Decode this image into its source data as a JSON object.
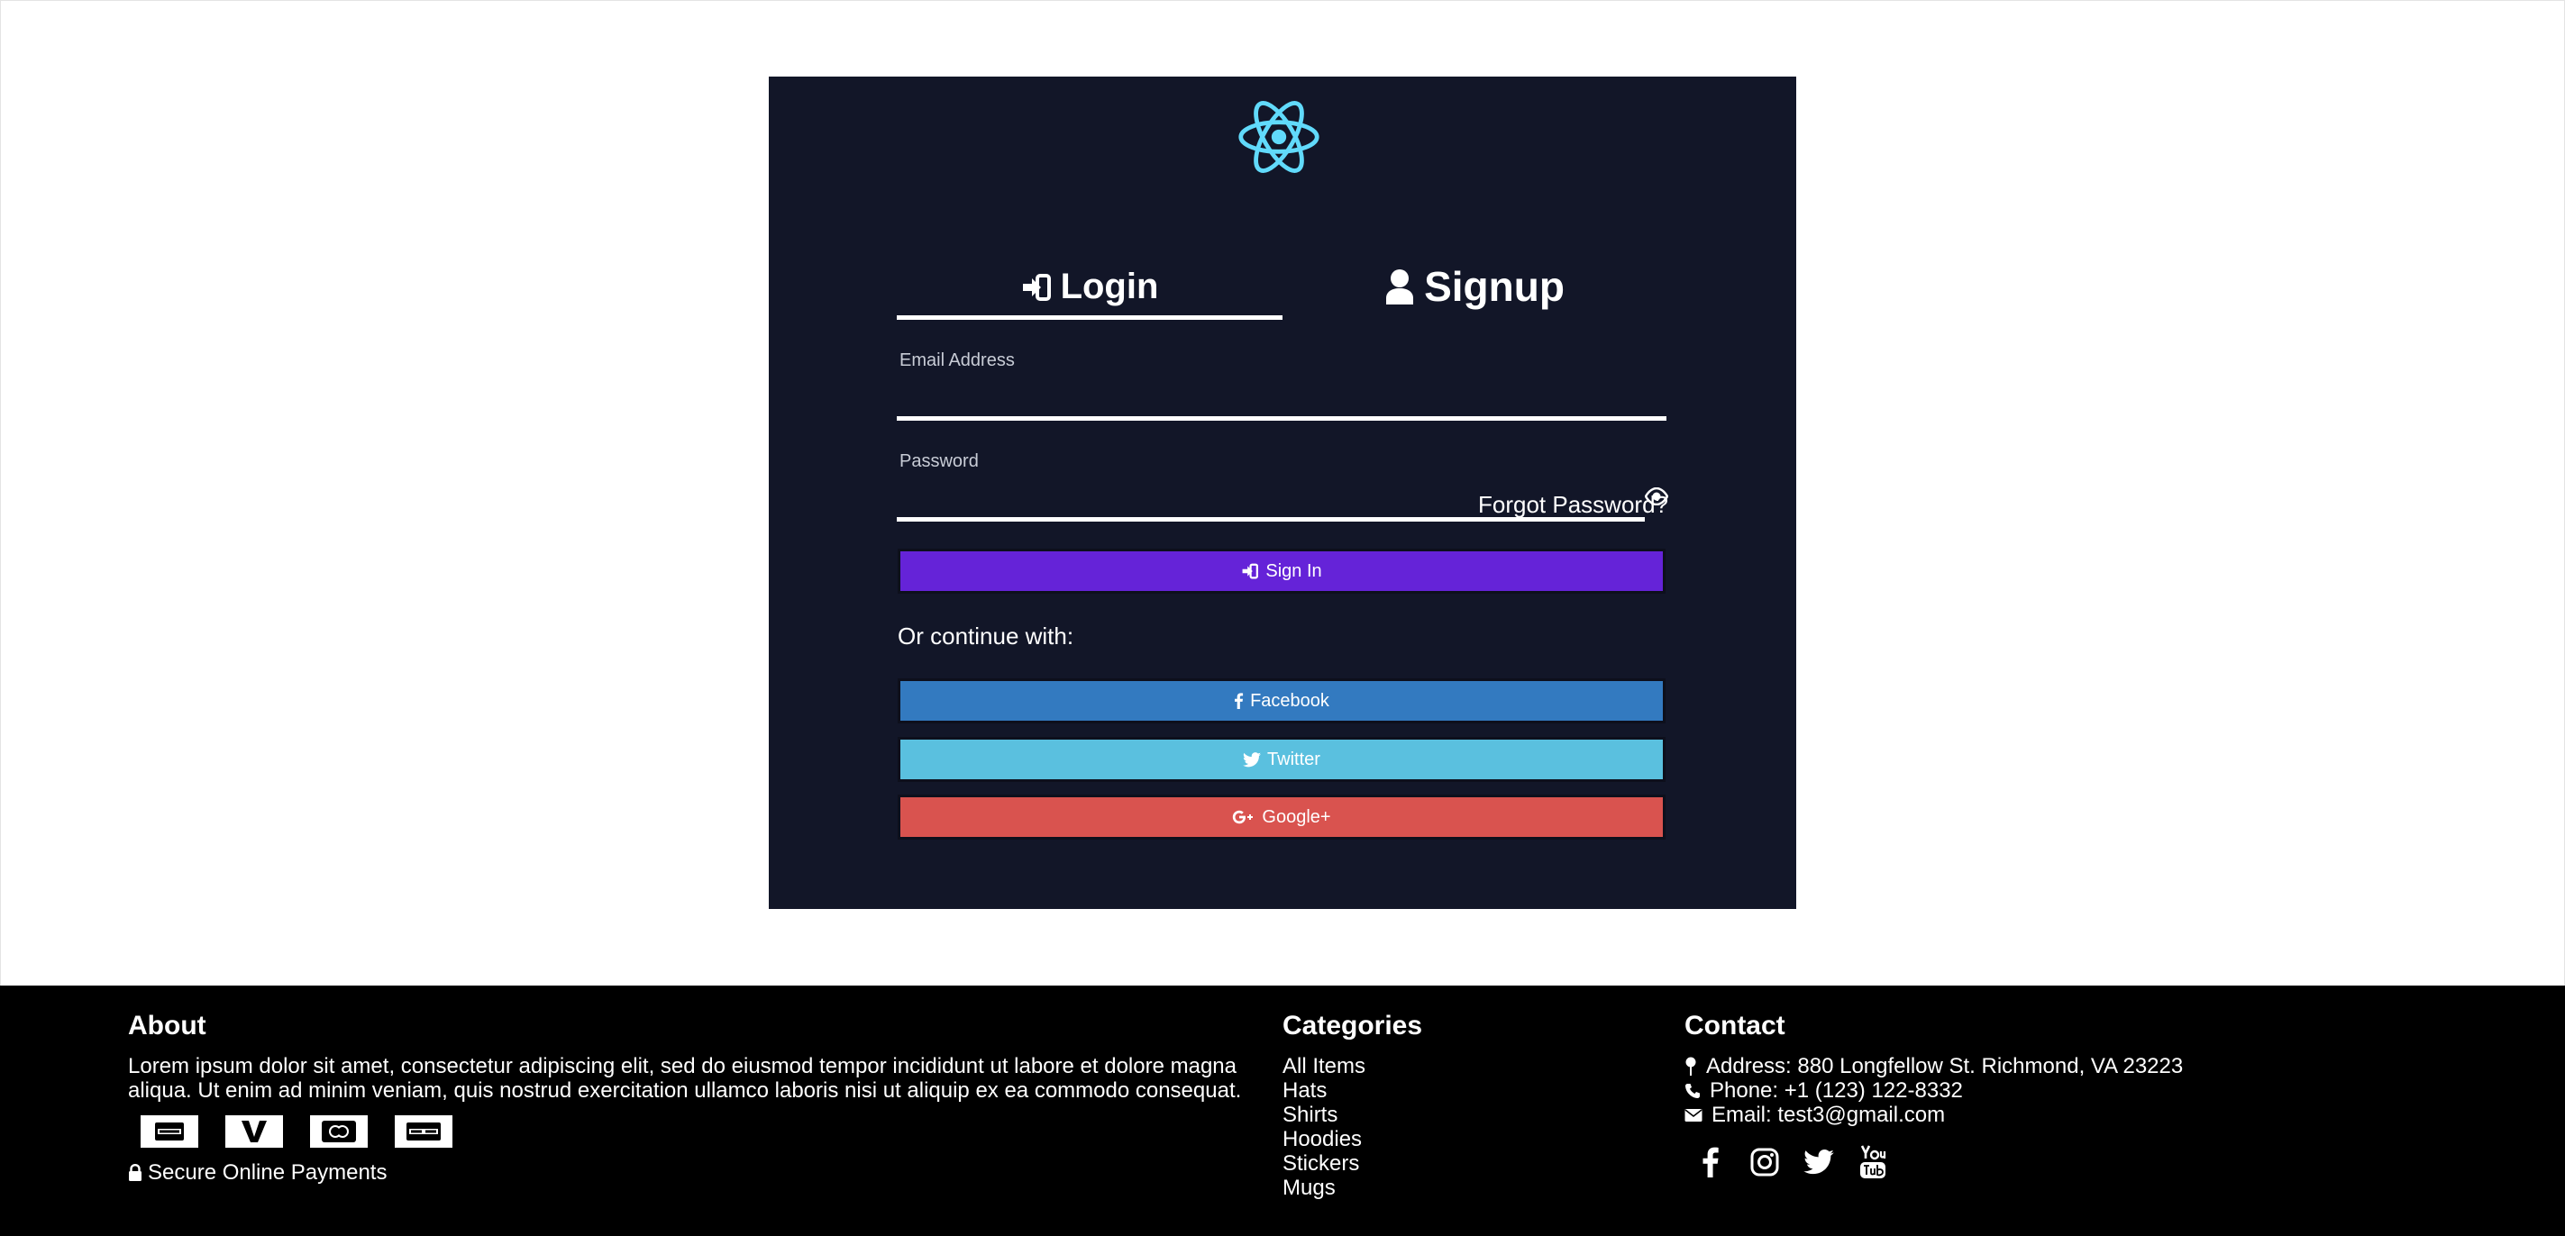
{
  "auth": {
    "tabs": {
      "login": "Login",
      "signup": "Signup"
    },
    "email": {
      "label": "Email Address",
      "value": ""
    },
    "password": {
      "label": "Password",
      "value": ""
    },
    "forgot": "Forgot Password?",
    "sign_in": "Sign In",
    "continue_text": "Or continue with:",
    "social_buttons": {
      "facebook": "Facebook",
      "twitter": "Twitter",
      "google": "Google+"
    },
    "colors": {
      "card_bg": "#121628",
      "sign_in": "#6523d8",
      "facebook": "#337ac0",
      "twitter": "#5ac0df",
      "google": "#d9534f",
      "logo": "#61dafb"
    }
  },
  "footer": {
    "about": {
      "title": "About",
      "text": "Lorem ipsum dolor sit amet, consectetur adipiscing elit, sed do eiusmod tempor incididunt ut labore et dolore magna aliqua. Ut enim ad minim veniam, quis nostrud exercitation ullamco laboris nisi ut aliquip ex ea commodo consequat.",
      "secure": "Secure Online Payments"
    },
    "categories": {
      "title": "Categories",
      "items": [
        "All Items",
        "Hats",
        "Shirts",
        "Hoodies",
        "Stickers",
        "Mugs"
      ]
    },
    "contact": {
      "title": "Contact",
      "address": "Address: 880 Longfellow St. Richmond, VA 23223",
      "phone": "Phone: +1 (123) 122-8332",
      "email": "Email: test3@gmail.com"
    }
  }
}
